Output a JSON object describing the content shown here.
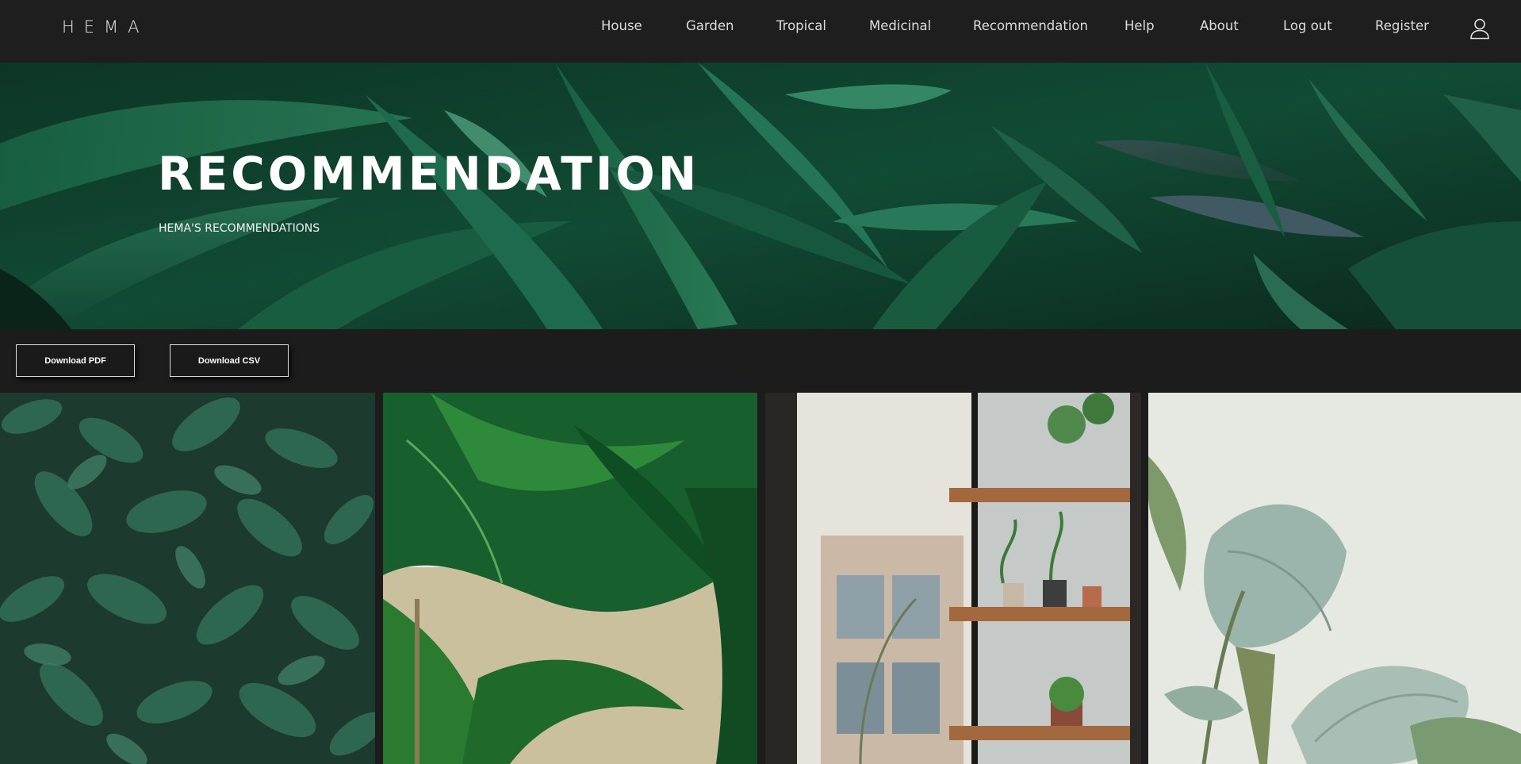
{
  "brand": {
    "logo_text": "HEMA"
  },
  "nav": {
    "items": [
      {
        "label": "House"
      },
      {
        "label": "Garden"
      },
      {
        "label": "Tropical"
      },
      {
        "label": "Medicinal"
      },
      {
        "label": "Recommendation"
      },
      {
        "label": "Help"
      },
      {
        "label": "About"
      },
      {
        "label": "Log out"
      },
      {
        "label": "Register"
      }
    ],
    "user_icon": "user-icon"
  },
  "hero": {
    "title": "RECOMMENDATION",
    "subtitle": "HEMA'S RECOMMENDATIONS"
  },
  "actions": {
    "download_pdf_label": "Download PDF",
    "download_csv_label": "Download CSV"
  },
  "gallery": {
    "tiles": [
      {
        "image": "dense-green-leaves-photo"
      },
      {
        "image": "tropical-palm-leaves-photo"
      },
      {
        "image": "shelf-with-potted-plants-photo"
      },
      {
        "image": "rubber-plant-leaves-photo"
      }
    ]
  },
  "colors": {
    "background": "#1c1c1c",
    "topbar": "#1e1e1e",
    "nav_text": "#dcdcdc",
    "leaf_green": "#1f6b4a"
  }
}
